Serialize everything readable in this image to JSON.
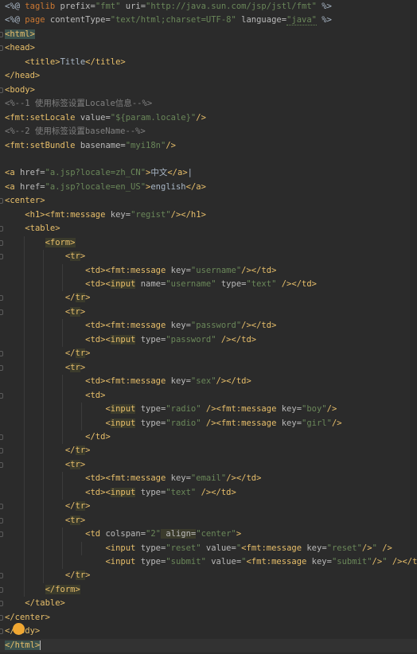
{
  "editor": {
    "lines": [
      [
        {
          "c": "t-txt",
          "t": "<%@ "
        },
        {
          "c": "t-kw",
          "t": "taglib"
        },
        {
          "c": "t-attr",
          "t": " prefix="
        },
        {
          "c": "t-str",
          "t": "\"fmt\""
        },
        {
          "c": "t-attr",
          "t": " uri="
        },
        {
          "c": "t-str",
          "t": "\"http://java.sun.com/jsp/jstl/fmt\""
        },
        {
          "c": "t-txt",
          "t": " %>"
        }
      ],
      [
        {
          "c": "t-txt",
          "t": "<%@ "
        },
        {
          "c": "t-kw",
          "t": "page"
        },
        {
          "c": "t-attr",
          "t": " contentType="
        },
        {
          "c": "t-str",
          "t": "\"text/html;charset=UTF-8\""
        },
        {
          "c": "t-attr",
          "t": " language="
        },
        {
          "c": "t-str t-under",
          "t": "\"java\""
        },
        {
          "c": "t-txt",
          "t": " %>"
        }
      ],
      [
        {
          "c": "t-tag t-match",
          "t": "<html>"
        }
      ],
      [
        {
          "c": "t-tag",
          "t": "<head>"
        }
      ],
      [
        {
          "c": "t-txt",
          "t": "    "
        },
        {
          "c": "t-tag",
          "t": "<title>"
        },
        {
          "c": "t-txt",
          "t": "Title"
        },
        {
          "c": "t-tag",
          "t": "</title>"
        }
      ],
      [
        {
          "c": "t-tag",
          "t": "</head>"
        }
      ],
      [
        {
          "c": "t-tag",
          "t": "<body>"
        }
      ],
      [
        {
          "c": "t-cmt",
          "t": "<%--1 使用标签设置Locale信息--%>"
        }
      ],
      [
        {
          "c": "t-tag",
          "t": "<fmt:setLocale"
        },
        {
          "c": "t-attr",
          "t": " value="
        },
        {
          "c": "t-str",
          "t": "\"${param.locale}\""
        },
        {
          "c": "t-tag",
          "t": "/>"
        }
      ],
      [
        {
          "c": "t-cmt",
          "t": "<%--2 使用标签设置baseName--%>"
        }
      ],
      [
        {
          "c": "t-tag",
          "t": "<fmt:setBundle"
        },
        {
          "c": "t-attr",
          "t": " basename="
        },
        {
          "c": "t-str",
          "t": "\"myi18n\""
        },
        {
          "c": "t-tag",
          "t": "/>"
        }
      ],
      [],
      [
        {
          "c": "t-tag",
          "t": "<a"
        },
        {
          "c": "t-attr",
          "t": " href="
        },
        {
          "c": "t-str",
          "t": "\"a.jsp?locale=zh_CN\""
        },
        {
          "c": "t-tag",
          "t": ">"
        },
        {
          "c": "t-txt",
          "t": "中文"
        },
        {
          "c": "t-tag",
          "t": "</a>"
        },
        {
          "c": "t-txt",
          "t": "|"
        }
      ],
      [
        {
          "c": "t-tag",
          "t": "<a"
        },
        {
          "c": "t-attr",
          "t": " href="
        },
        {
          "c": "t-str",
          "t": "\"a.jsp?locale=en_US\""
        },
        {
          "c": "t-tag",
          "t": ">"
        },
        {
          "c": "t-txt",
          "t": "english"
        },
        {
          "c": "t-tag",
          "t": "</a>"
        }
      ],
      [
        {
          "c": "t-tag",
          "t": "<center>"
        }
      ],
      [
        {
          "c": "t-txt",
          "t": "    "
        },
        {
          "c": "t-tag",
          "t": "<h1><fmt:message"
        },
        {
          "c": "t-attr",
          "t": " key="
        },
        {
          "c": "t-str",
          "t": "\"regist\""
        },
        {
          "c": "t-tag",
          "t": "/></h1>"
        }
      ],
      [
        {
          "c": "t-txt",
          "t": "    "
        },
        {
          "c": "t-tag",
          "t": "<table>"
        }
      ],
      [
        {
          "c": "t-txt",
          "t": "        "
        },
        {
          "c": "t-tag t-hl",
          "t": "<form>"
        }
      ],
      [
        {
          "c": "t-txt",
          "t": "            "
        },
        {
          "c": "t-tag",
          "t": "<"
        },
        {
          "c": "t-tag t-hl",
          "t": "tr"
        },
        {
          "c": "t-tag",
          "t": ">"
        }
      ],
      [
        {
          "c": "t-txt",
          "t": "                "
        },
        {
          "c": "t-tag",
          "t": "<td><fmt:message"
        },
        {
          "c": "t-attr",
          "t": " key="
        },
        {
          "c": "t-str",
          "t": "\"username\""
        },
        {
          "c": "t-tag",
          "t": "/></td>"
        }
      ],
      [
        {
          "c": "t-txt",
          "t": "                "
        },
        {
          "c": "t-tag",
          "t": "<td><"
        },
        {
          "c": "t-tag t-hl",
          "t": "input"
        },
        {
          "c": "t-attr",
          "t": " name="
        },
        {
          "c": "t-str",
          "t": "\"username\""
        },
        {
          "c": "t-attr",
          "t": " type="
        },
        {
          "c": "t-str",
          "t": "\"text\""
        },
        {
          "c": "t-tag",
          "t": " /></td>"
        }
      ],
      [
        {
          "c": "t-txt",
          "t": "            "
        },
        {
          "c": "t-tag",
          "t": "</"
        },
        {
          "c": "t-tag t-hl",
          "t": "tr"
        },
        {
          "c": "t-tag",
          "t": ">"
        }
      ],
      [
        {
          "c": "t-txt",
          "t": "            "
        },
        {
          "c": "t-tag",
          "t": "<"
        },
        {
          "c": "t-tag t-hl",
          "t": "tr"
        },
        {
          "c": "t-tag",
          "t": ">"
        }
      ],
      [
        {
          "c": "t-txt",
          "t": "                "
        },
        {
          "c": "t-tag",
          "t": "<td><fmt:message"
        },
        {
          "c": "t-attr",
          "t": " key="
        },
        {
          "c": "t-str",
          "t": "\"password\""
        },
        {
          "c": "t-tag",
          "t": "/></td>"
        }
      ],
      [
        {
          "c": "t-txt",
          "t": "                "
        },
        {
          "c": "t-tag",
          "t": "<td><"
        },
        {
          "c": "t-tag t-hl",
          "t": "input"
        },
        {
          "c": "t-attr",
          "t": " type="
        },
        {
          "c": "t-str",
          "t": "\"password\""
        },
        {
          "c": "t-tag",
          "t": " /></td>"
        }
      ],
      [
        {
          "c": "t-txt",
          "t": "            "
        },
        {
          "c": "t-tag",
          "t": "</"
        },
        {
          "c": "t-tag t-hl",
          "t": "tr"
        },
        {
          "c": "t-tag",
          "t": ">"
        }
      ],
      [
        {
          "c": "t-txt",
          "t": "            "
        },
        {
          "c": "t-tag",
          "t": "<"
        },
        {
          "c": "t-tag t-hl",
          "t": "tr"
        },
        {
          "c": "t-tag",
          "t": ">"
        }
      ],
      [
        {
          "c": "t-txt",
          "t": "                "
        },
        {
          "c": "t-tag",
          "t": "<td><fmt:message"
        },
        {
          "c": "t-attr",
          "t": " key="
        },
        {
          "c": "t-str",
          "t": "\"sex\""
        },
        {
          "c": "t-tag",
          "t": "/></td>"
        }
      ],
      [
        {
          "c": "t-txt",
          "t": "                "
        },
        {
          "c": "t-tag",
          "t": "<td>"
        }
      ],
      [
        {
          "c": "t-txt",
          "t": "                    "
        },
        {
          "c": "t-tag",
          "t": "<"
        },
        {
          "c": "t-tag t-hl",
          "t": "input"
        },
        {
          "c": "t-attr",
          "t": " type="
        },
        {
          "c": "t-str",
          "t": "\"radio\""
        },
        {
          "c": "t-tag",
          "t": " /><fmt:message"
        },
        {
          "c": "t-attr",
          "t": " key="
        },
        {
          "c": "t-str",
          "t": "\"boy\""
        },
        {
          "c": "t-tag",
          "t": "/>"
        }
      ],
      [
        {
          "c": "t-txt",
          "t": "                    "
        },
        {
          "c": "t-tag",
          "t": "<"
        },
        {
          "c": "t-tag t-hl",
          "t": "input"
        },
        {
          "c": "t-attr",
          "t": " type="
        },
        {
          "c": "t-str",
          "t": "\"radio\""
        },
        {
          "c": "t-tag",
          "t": " /><fmt:message"
        },
        {
          "c": "t-attr",
          "t": " key="
        },
        {
          "c": "t-str",
          "t": "\"girl\""
        },
        {
          "c": "t-tag",
          "t": "/>"
        }
      ],
      [
        {
          "c": "t-txt",
          "t": "                "
        },
        {
          "c": "t-tag",
          "t": "</td>"
        }
      ],
      [
        {
          "c": "t-txt",
          "t": "            "
        },
        {
          "c": "t-tag",
          "t": "</"
        },
        {
          "c": "t-tag t-hl",
          "t": "tr"
        },
        {
          "c": "t-tag",
          "t": ">"
        }
      ],
      [
        {
          "c": "t-txt",
          "t": "            "
        },
        {
          "c": "t-tag",
          "t": "<"
        },
        {
          "c": "t-tag t-hl",
          "t": "tr"
        },
        {
          "c": "t-tag",
          "t": ">"
        }
      ],
      [
        {
          "c": "t-txt",
          "t": "                "
        },
        {
          "c": "t-tag",
          "t": "<td><fmt:message"
        },
        {
          "c": "t-attr",
          "t": " key="
        },
        {
          "c": "t-str",
          "t": "\"email\""
        },
        {
          "c": "t-tag",
          "t": "/></td>"
        }
      ],
      [
        {
          "c": "t-txt",
          "t": "                "
        },
        {
          "c": "t-tag",
          "t": "<td><"
        },
        {
          "c": "t-tag t-hl",
          "t": "input"
        },
        {
          "c": "t-attr",
          "t": " type="
        },
        {
          "c": "t-str",
          "t": "\"text\""
        },
        {
          "c": "t-tag",
          "t": " /></td>"
        }
      ],
      [
        {
          "c": "t-txt",
          "t": "            "
        },
        {
          "c": "t-tag",
          "t": "</"
        },
        {
          "c": "t-tag t-hl",
          "t": "tr"
        },
        {
          "c": "t-tag",
          "t": ">"
        }
      ],
      [
        {
          "c": "t-txt",
          "t": "            "
        },
        {
          "c": "t-tag",
          "t": "<"
        },
        {
          "c": "t-tag t-hl",
          "t": "tr"
        },
        {
          "c": "t-tag",
          "t": ">"
        }
      ],
      [
        {
          "c": "t-txt",
          "t": "                "
        },
        {
          "c": "t-tag",
          "t": "<td"
        },
        {
          "c": "t-attr",
          "t": " colspan="
        },
        {
          "c": "t-str",
          "t": "\"2\""
        },
        {
          "c": "t-attr t-hl",
          "t": " align="
        },
        {
          "c": "t-str",
          "t": "\"center\""
        },
        {
          "c": "t-tag",
          "t": ">"
        }
      ],
      [
        {
          "c": "t-txt",
          "t": "                    "
        },
        {
          "c": "t-tag",
          "t": "<input"
        },
        {
          "c": "t-attr",
          "t": " type="
        },
        {
          "c": "t-str",
          "t": "\"reset\""
        },
        {
          "c": "t-attr",
          "t": " value="
        },
        {
          "c": "t-str",
          "t": "\""
        },
        {
          "c": "t-tag",
          "t": "<fmt:message"
        },
        {
          "c": "t-attr",
          "t": " key="
        },
        {
          "c": "t-str",
          "t": "\"reset\""
        },
        {
          "c": "t-tag",
          "t": "/>"
        },
        {
          "c": "t-str",
          "t": "\""
        },
        {
          "c": "t-tag",
          "t": " /> "
        }
      ],
      [
        {
          "c": "t-txt",
          "t": "                    "
        },
        {
          "c": "t-tag",
          "t": "<input"
        },
        {
          "c": "t-attr",
          "t": " type="
        },
        {
          "c": "t-str",
          "t": "\"submit\""
        },
        {
          "c": "t-attr",
          "t": " value="
        },
        {
          "c": "t-str",
          "t": "\""
        },
        {
          "c": "t-tag",
          "t": "<fmt:message"
        },
        {
          "c": "t-attr",
          "t": " key="
        },
        {
          "c": "t-str",
          "t": "\"submit\""
        },
        {
          "c": "t-tag",
          "t": "/>"
        },
        {
          "c": "t-str",
          "t": "\""
        },
        {
          "c": "t-tag",
          "t": " /></td>"
        }
      ],
      [
        {
          "c": "t-txt",
          "t": "            "
        },
        {
          "c": "t-tag",
          "t": "</"
        },
        {
          "c": "t-tag t-hl",
          "t": "tr"
        },
        {
          "c": "t-tag",
          "t": ">"
        }
      ],
      [
        {
          "c": "t-txt",
          "t": "        "
        },
        {
          "c": "t-tag t-hl",
          "t": "</form>"
        }
      ],
      [
        {
          "c": "t-txt",
          "t": "    "
        },
        {
          "c": "t-tag",
          "t": "</table>"
        }
      ],
      [
        {
          "c": "t-tag",
          "t": "</center>"
        }
      ],
      [
        {
          "c": "t-tag",
          "t": "</body>"
        }
      ],
      [
        {
          "c": "t-tag t-match",
          "t": "</html>"
        },
        {
          "c": "caret",
          "t": ""
        }
      ]
    ],
    "current_line": 46,
    "fold_marks": [
      2,
      3,
      6,
      14,
      16,
      17,
      18,
      21,
      22,
      25,
      26,
      28,
      31,
      32,
      33,
      36,
      37,
      38,
      41,
      42,
      43,
      44,
      45,
      46
    ]
  }
}
